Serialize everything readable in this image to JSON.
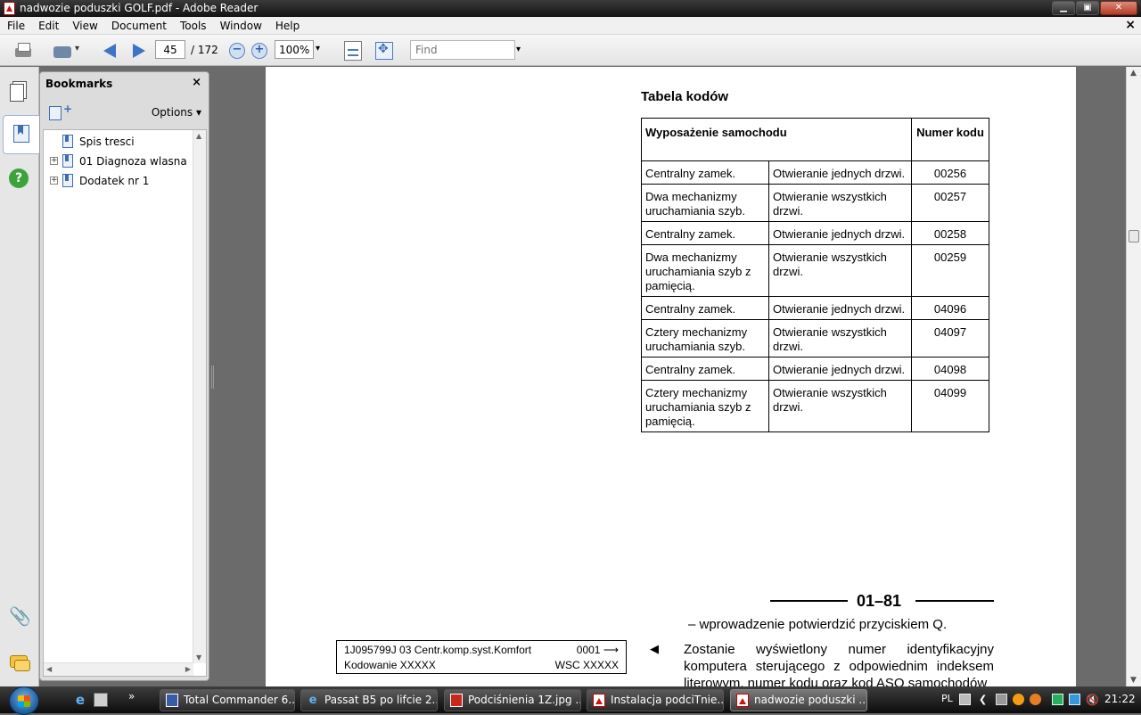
{
  "window": {
    "title": "nadwozie poduszki GOLF.pdf - Adobe Reader",
    "minimize": "▁",
    "maximize": "▣",
    "close": "✕"
  },
  "menu": [
    "File",
    "Edit",
    "View",
    "Document",
    "Tools",
    "Window",
    "Help"
  ],
  "menu_close": "×",
  "toolbar": {
    "page_current": "45",
    "page_total": "/ 172",
    "zoom": "100%",
    "find_placeholder": "Find"
  },
  "bookmarks": {
    "title": "Bookmarks",
    "close": "×",
    "options": "Options ▾",
    "items": [
      {
        "label": "Spis tresci",
        "expandable": false
      },
      {
        "label": "01 Diagnoza wlasna",
        "expandable": true
      },
      {
        "label": "Dodatek nr 1",
        "expandable": true
      }
    ]
  },
  "document": {
    "heading": "Tabela kodów",
    "table": {
      "header_equipment": "Wyposażenie samochodu",
      "header_code": "Numer kodu",
      "rows": [
        {
          "equipment": "Centralny zamek.",
          "opening": "Otwieranie jednych drzwi.",
          "code": "00256"
        },
        {
          "equipment": "Dwa mechanizmy uruchamiania szyb.",
          "opening": "Otwieranie wszystkich drzwi.",
          "code": "00257"
        },
        {
          "equipment": "Centralny zamek.",
          "opening": "Otwieranie jednych drzwi.",
          "code": "00258"
        },
        {
          "equipment": "Dwa mechanizmy uruchamiania szyb z pamięcią.",
          "opening": "Otwieranie wszystkich drzwi.",
          "code": "00259"
        },
        {
          "equipment": "Centralny zamek.",
          "opening": "Otwieranie jednych drzwi.",
          "code": "04096"
        },
        {
          "equipment": "Cztery mechanizmy uruchamiania szyb.",
          "opening": "Otwieranie wszystkich drzwi.",
          "code": "04097"
        },
        {
          "equipment": "Centralny zamek.",
          "opening": "Otwieranie jednych drzwi.",
          "code": "04098"
        },
        {
          "equipment": "Cztery mechanizmy uruchamiania szyb z pamięcią.",
          "opening": "Otwieranie wszystkich drzwi.",
          "code": "04099"
        }
      ]
    },
    "page_number": "01–81",
    "instruction": "– wprowadzenie potwierdzić przyciskiem Q.",
    "screen_box": {
      "line1_left": "1J095799J 03 Centr.komp.syst.Komfort",
      "line1_right": "0001 ⟶",
      "line2_left": "Kodowanie XXXXX",
      "line2_right": "WSC XXXXX"
    },
    "marker": "◀",
    "paragraph": "Zostanie wyświetlony numer identyfikacyjny komputera sterującego z odpowiednim indeksem literowym, numer kodu oraz kod ASO samochodów"
  },
  "taskbar": {
    "more": "»",
    "tasks": [
      {
        "label": "Total Commander 6....",
        "icon": "total-commander-icon"
      },
      {
        "label": "Passat B5 po lifcie 2...",
        "icon": "ie-icon"
      },
      {
        "label": "Podciśnienia 1Z.jpg ...",
        "icon": "image-viewer-icon"
      },
      {
        "label": "Instalacja podciTnie...",
        "icon": "pdf-icon"
      },
      {
        "label": "nadwozie poduszki ...",
        "icon": "pdf-icon"
      }
    ],
    "language": "PL",
    "time": "21:22"
  }
}
